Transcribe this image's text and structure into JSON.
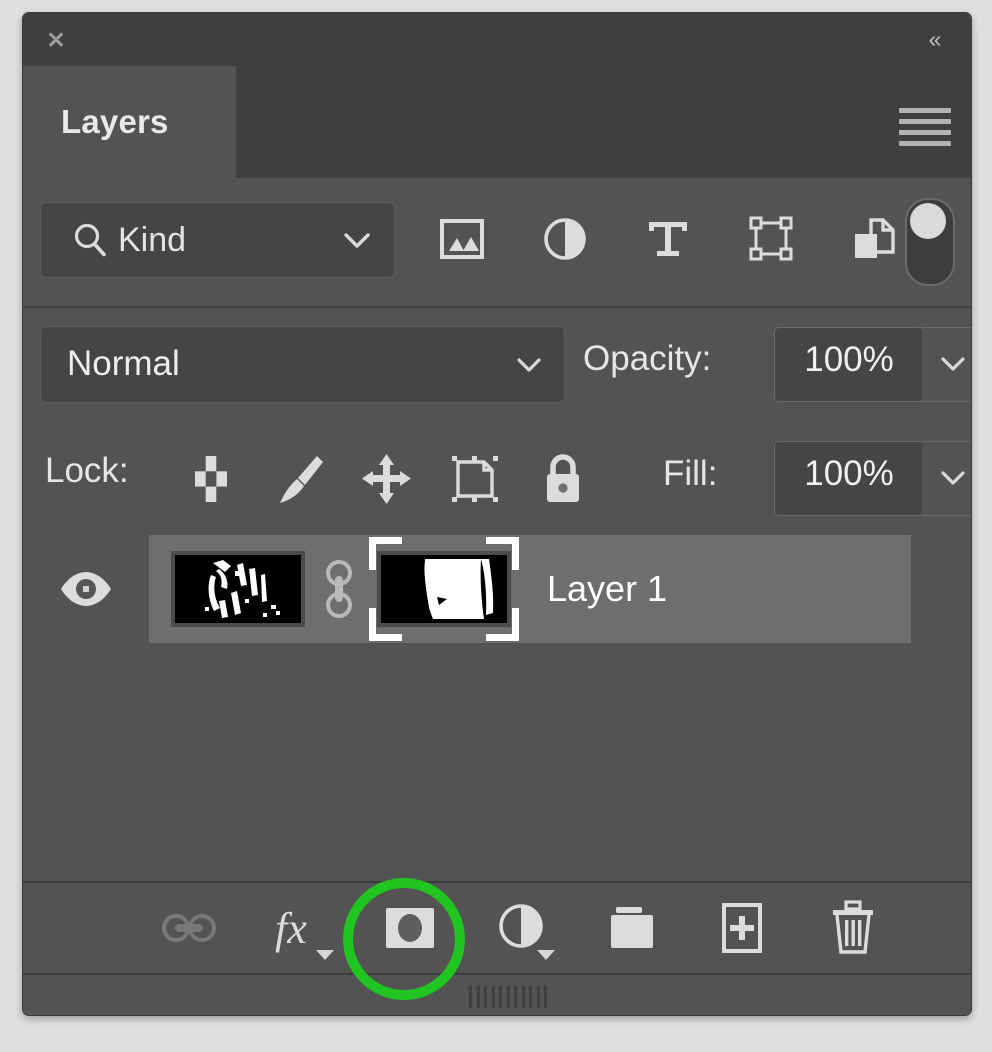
{
  "window": {
    "close_icon": "close-x-icon",
    "collapse_icon": "collapse-double-chevron-icon",
    "collapse_glyph": "«",
    "close_glyph": "✕"
  },
  "tabs": [
    {
      "label": "Layers",
      "active": true
    }
  ],
  "panel_menu": {
    "icon": "hamburger-menu-icon"
  },
  "filter": {
    "kind_label": "Kind",
    "search_icon": "search-icon",
    "chevron_icon": "chevron-down-icon",
    "icons": [
      {
        "name": "filter-pixel-layers-icon",
        "title": "Pixel layers"
      },
      {
        "name": "filter-adjustment-layers-icon",
        "title": "Adjustment layers"
      },
      {
        "name": "filter-type-layers-icon",
        "title": "Type layers"
      },
      {
        "name": "filter-shape-layers-icon",
        "title": "Shape layers"
      },
      {
        "name": "filter-smart-objects-icon",
        "title": "Smart objects"
      }
    ],
    "toggle": {
      "name": "filter-enable-toggle",
      "state": "off"
    }
  },
  "blend": {
    "mode": "Normal",
    "mode_chevron": "chevron-down-icon",
    "opacity_label": "Opacity:",
    "opacity_value": "100%",
    "opacity_chevron": "chevron-down-icon"
  },
  "lock": {
    "label": "Lock:",
    "icons": [
      {
        "name": "lock-transparent-pixels-icon"
      },
      {
        "name": "lock-image-pixels-icon"
      },
      {
        "name": "lock-position-icon"
      },
      {
        "name": "lock-artboard-nesting-icon"
      },
      {
        "name": "lock-all-icon"
      }
    ],
    "fill_label": "Fill:",
    "fill_value": "100%",
    "fill_chevron": "chevron-down-icon"
  },
  "layers": [
    {
      "name": "Layer 1",
      "visible": true,
      "selected": true,
      "visibility_icon": "eye-icon",
      "link_icon": "mask-link-icon",
      "mask_selected": true
    }
  ],
  "bottom_toolbar": [
    {
      "name": "link-layers-button",
      "icon": "link-icon",
      "disabled": true,
      "caret": false
    },
    {
      "name": "layer-style-button",
      "icon": "fx-icon",
      "label": "fx",
      "disabled": false,
      "caret": true
    },
    {
      "name": "add-layer-mask-button",
      "icon": "add-layer-mask-icon",
      "disabled": false,
      "caret": false,
      "highlighted": true
    },
    {
      "name": "new-adjustment-layer-button",
      "icon": "half-filled-circle-icon",
      "disabled": false,
      "caret": true
    },
    {
      "name": "new-group-button",
      "icon": "folder-icon",
      "disabled": false,
      "caret": false
    },
    {
      "name": "new-layer-button",
      "icon": "new-layer-plus-icon",
      "disabled": false,
      "caret": false
    },
    {
      "name": "delete-layer-button",
      "icon": "trash-icon",
      "disabled": false,
      "caret": false
    }
  ],
  "annotation": {
    "target": "add-layer-mask-button",
    "shape": "circle",
    "color": "#21c521"
  },
  "colors": {
    "panel_bg": "#535353",
    "titlebar_bg": "#3f3f3f",
    "field_bg": "#454545",
    "selected_row": "#6e6e6e",
    "icon": "#d6d6d6",
    "text": "#e8e8e8",
    "annotation_green": "#21c521"
  }
}
